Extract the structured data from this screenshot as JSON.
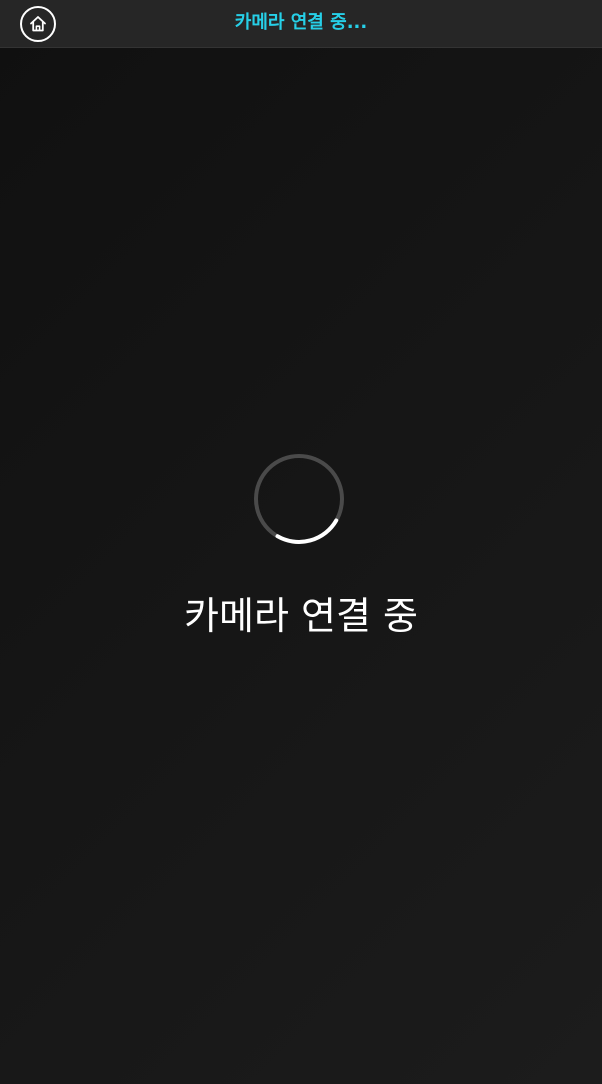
{
  "header": {
    "title": "카메라 연결 중...",
    "home_icon": "home-icon",
    "title_color": "#26d0e8"
  },
  "main": {
    "status_text": "카메라 연결 중",
    "spinner_icon": "loading-spinner-icon"
  }
}
